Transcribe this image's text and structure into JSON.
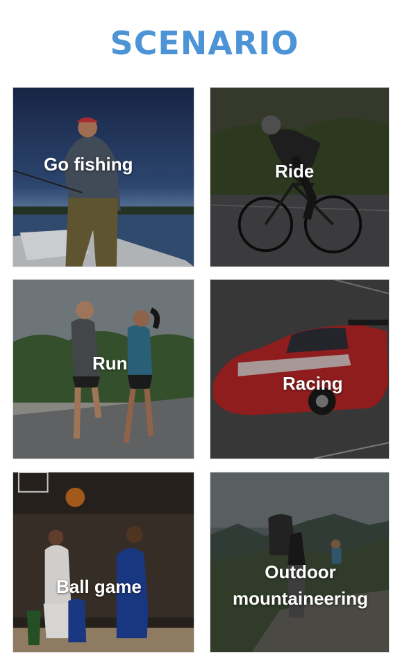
{
  "header": {
    "title": "SCENARIO"
  },
  "scenarios": [
    {
      "label": "Go fishing",
      "icon": "fishing-scene"
    },
    {
      "label": "Ride",
      "icon": "cycling-scene"
    },
    {
      "label": "Run",
      "icon": "running-scene"
    },
    {
      "label": "Racing",
      "icon": "race-car-scene"
    },
    {
      "label": "Ball game",
      "icon": "basketball-scene"
    },
    {
      "label": "Outdoor mountaineering",
      "icon": "mountaineering-scene"
    }
  ]
}
